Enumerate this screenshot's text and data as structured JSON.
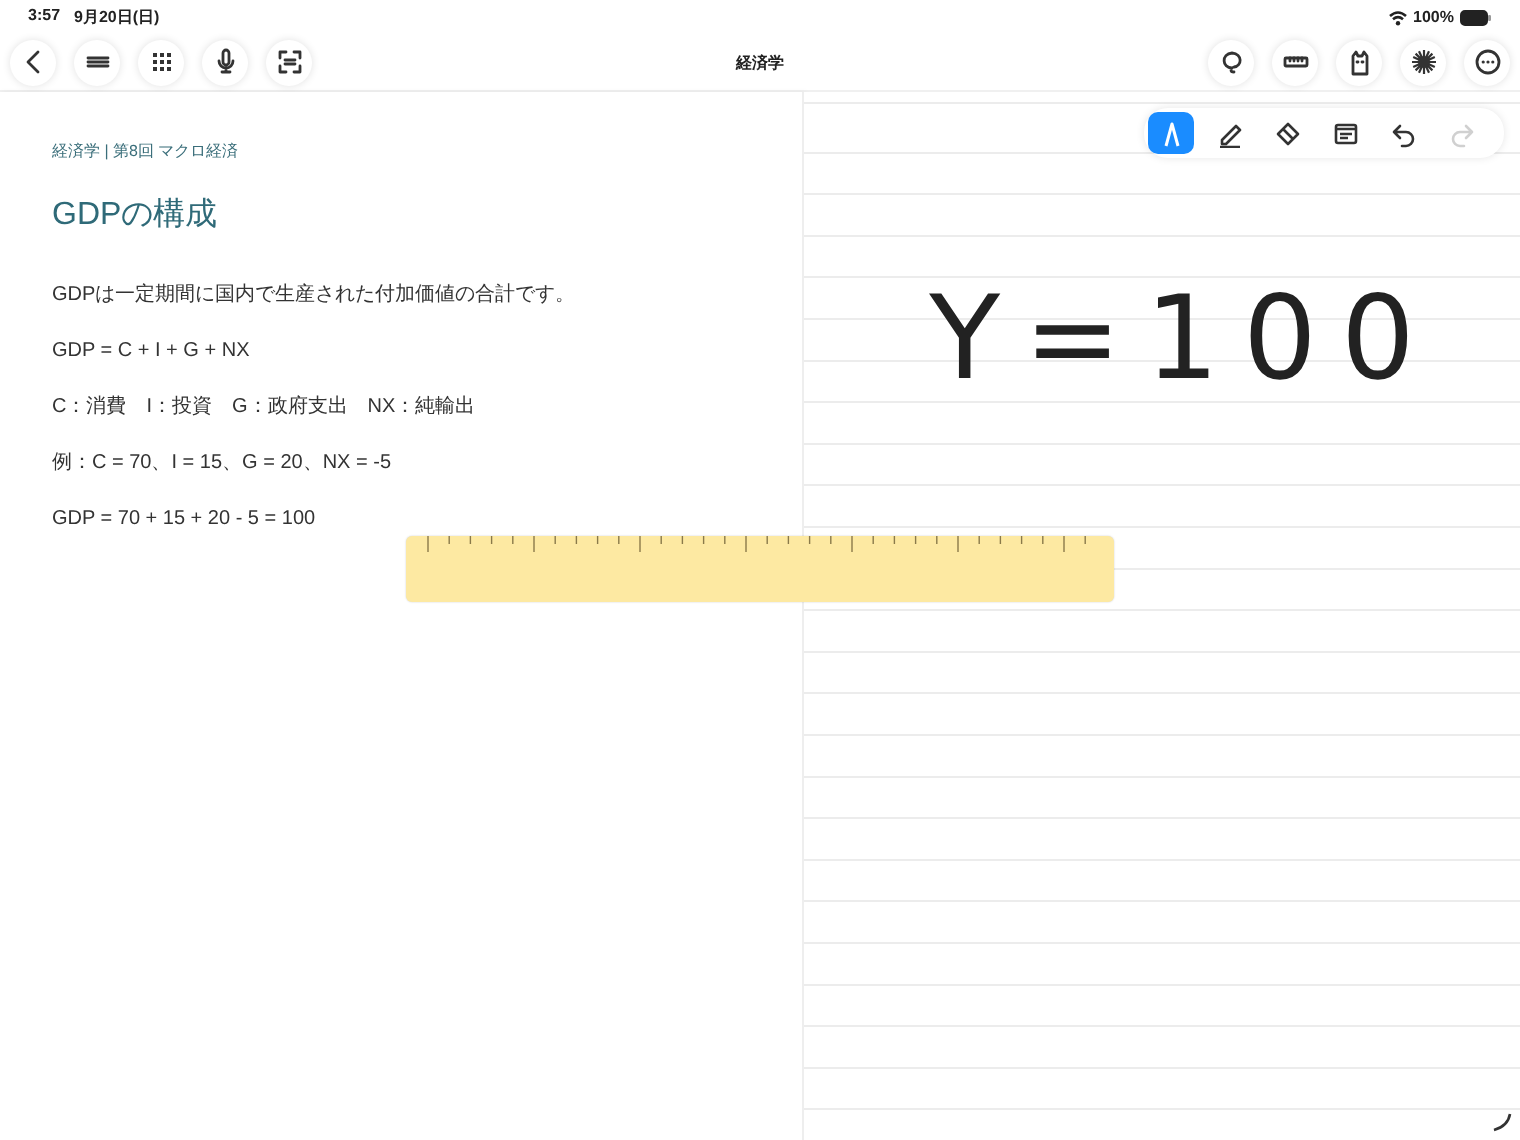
{
  "status_bar": {
    "time": "3:57",
    "date": "9月20日(日)",
    "battery": "100%"
  },
  "top_bar": {
    "title": "経済学"
  },
  "page": {
    "breadcrumb": "経済学 | 第8回 マクロ経済",
    "heading": "GDPの構成",
    "lines": [
      "GDPは一定期間に国内で生産された付加価値の合計です。",
      "GDP = C + I + G + NX",
      "C：消費　I：投資　G：政府支出　NX：純輸出",
      "例：C = 70、I = 15、G = 20、NX = -5",
      "GDP = 70 + 15 + 20 - 5 = 100"
    ]
  },
  "pen_tools": [
    {
      "kind": "pen",
      "selected": true,
      "disabled": false
    },
    {
      "kind": "highlighter",
      "selected": false,
      "disabled": false
    },
    {
      "kind": "eraser",
      "selected": false,
      "disabled": false
    },
    {
      "kind": "format",
      "selected": false,
      "disabled": false
    },
    {
      "kind": "undo",
      "selected": false,
      "disabled": false
    },
    {
      "kind": "redo",
      "selected": false,
      "disabled": true
    }
  ],
  "note": {
    "handwriting": "Y=100"
  }
}
